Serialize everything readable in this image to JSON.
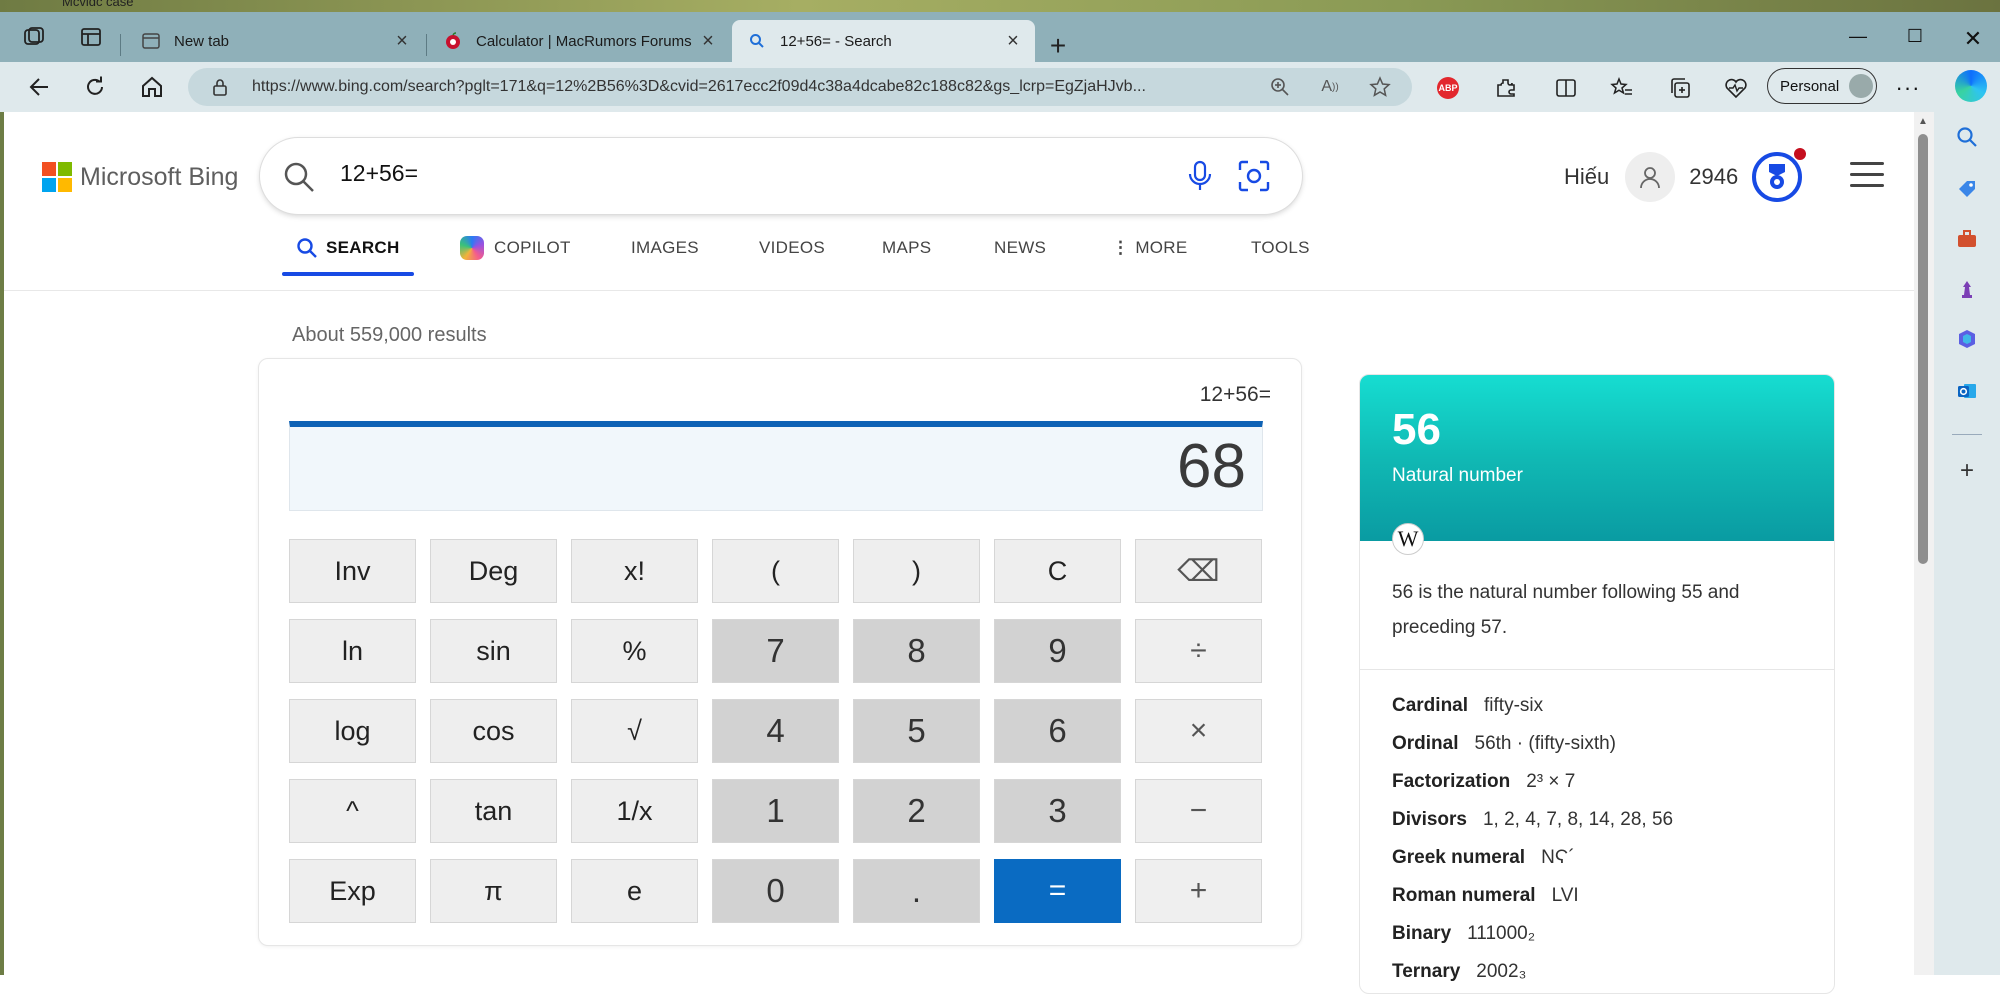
{
  "browser": {
    "desktop_label": "Mcvidc case",
    "tabs": [
      {
        "title": "New tab",
        "active": false
      },
      {
        "title": "Calculator | MacRumors Forums",
        "active": false
      },
      {
        "title": "12+56= - Search",
        "active": true
      }
    ],
    "url": "https://www.bing.com/search?pglt=171&q=12%2B56%3D&cvid=2617ecc2f09d4c38a4dcabe82c188c82&gs_lcrp=EgZjaHJvb...",
    "profile_label": "Personal",
    "abp_label": "ABP"
  },
  "bing": {
    "logo_text": "Microsoft Bing",
    "query": "12+56=",
    "user_name": "Hiếu",
    "points": "2946",
    "nav_tabs": [
      {
        "label": "SEARCH",
        "active": true
      },
      {
        "label": "COPILOT",
        "active": false
      },
      {
        "label": "IMAGES",
        "active": false
      },
      {
        "label": "VIDEOS",
        "active": false
      },
      {
        "label": "MAPS",
        "active": false
      },
      {
        "label": "NEWS",
        "active": false
      },
      {
        "label": "MORE",
        "active": false
      },
      {
        "label": "TOOLS",
        "active": false
      }
    ],
    "result_count": "About 559,000 results"
  },
  "calculator": {
    "expression": "12+56=",
    "result": "68",
    "keys": [
      [
        "Inv",
        "Deg",
        "x!",
        "(",
        ")",
        "C",
        "⌫"
      ],
      [
        "ln",
        "sin",
        "%",
        "7",
        "8",
        "9",
        "÷"
      ],
      [
        "log",
        "cos",
        "√",
        "4",
        "5",
        "6",
        "×"
      ],
      [
        "^",
        "tan",
        "1/x",
        "1",
        "2",
        "3",
        "−"
      ],
      [
        "Exp",
        "π",
        "e",
        "0",
        ".",
        "=",
        "+"
      ]
    ]
  },
  "knowledge_card": {
    "number": "56",
    "subtitle": "Natural number",
    "wiki_glyph": "W",
    "description": "56 is the natural number following 55 and preceding 57.",
    "facts": [
      {
        "key": "Cardinal",
        "value": "fifty-six"
      },
      {
        "key": "Ordinal",
        "value": "56th · (fifty-sixth)"
      },
      {
        "key": "Factorization",
        "value": "2³ × 7"
      },
      {
        "key": "Divisors",
        "value": "1, 2, 4, 7, 8, 14, 28, 56"
      },
      {
        "key": "Greek numeral",
        "value": "ΝϚ´"
      },
      {
        "key": "Roman numeral",
        "value": "LVI"
      },
      {
        "key": "Binary",
        "value": "111000₂"
      },
      {
        "key": "Ternary",
        "value": "2002₃"
      }
    ]
  },
  "colors": {
    "accent": "#174ae4",
    "equals_key": "#0a6bc2",
    "card_header": "#10b9b4"
  }
}
